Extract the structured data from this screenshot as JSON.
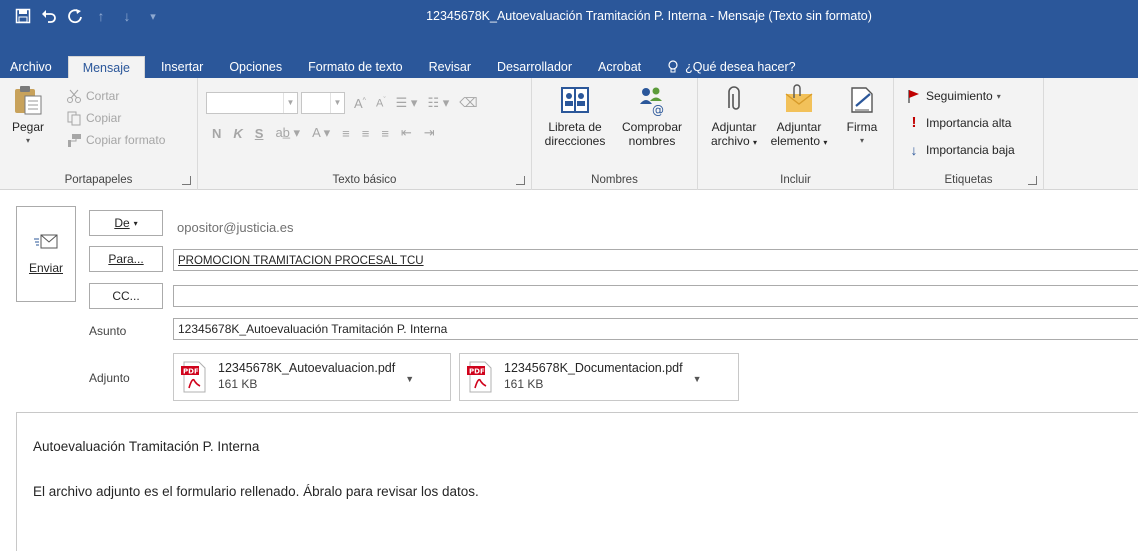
{
  "window": {
    "title": "12345678K_Autoevaluación Tramitación P. Interna  -  Mensaje (Texto sin formato)"
  },
  "quick_access": [
    {
      "name": "save-icon",
      "glyph": "🖫"
    },
    {
      "name": "undo-icon",
      "glyph": "↶"
    },
    {
      "name": "redo-icon",
      "glyph": "↻"
    },
    {
      "name": "up-arrow-icon",
      "glyph": "↑"
    },
    {
      "name": "down-arrow-icon",
      "glyph": "↓"
    },
    {
      "name": "customize-qat-icon",
      "glyph": "₹"
    }
  ],
  "tabs": [
    {
      "label": "Archivo"
    },
    {
      "label": "Mensaje",
      "active": true
    },
    {
      "label": "Insertar"
    },
    {
      "label": "Opciones"
    },
    {
      "label": "Formato de texto"
    },
    {
      "label": "Revisar"
    },
    {
      "label": "Desarrollador"
    },
    {
      "label": "Acrobat"
    }
  ],
  "tell_me": "¿Qué desea hacer?",
  "ribbon": {
    "clipboard": {
      "label": "Portapapeles",
      "paste": "Pegar",
      "cut": "Cortar",
      "copy": "Copiar",
      "format_painter": "Copiar formato"
    },
    "basic_text": {
      "label": "Texto básico",
      "bold": "N",
      "italic": "K",
      "underline": "S"
    },
    "names": {
      "label": "Nombres",
      "address_book_1": "Libreta de",
      "address_book_2": "direcciones",
      "check_names_1": "Comprobar",
      "check_names_2": "nombres"
    },
    "include": {
      "label": "Incluir",
      "attach_file_1": "Adjuntar",
      "attach_file_2": "archivo",
      "attach_item_1": "Adjuntar",
      "attach_item_2": "elemento",
      "signature": "Firma"
    },
    "tags": {
      "label": "Etiquetas",
      "follow_up": "Seguimiento",
      "high_importance": "Importancia alta",
      "low_importance": "Importancia baja"
    }
  },
  "compose": {
    "send": "Enviar",
    "from_button": "De",
    "from_value": "opositor@justicia.es",
    "to_button": "Para...",
    "to_value": "PROMOCION TRAMITACION PROCESAL TCU",
    "cc_button": "CC...",
    "cc_value": "",
    "subject_label": "Asunto",
    "subject_value": "12345678K_Autoevaluación Tramitación P. Interna",
    "attachment_label": "Adjunto",
    "attachments": [
      {
        "name": "12345678K_Autoevaluacion.pdf",
        "size": "161 KB"
      },
      {
        "name": "12345678K_Documentacion.pdf",
        "size": "161 KB"
      }
    ],
    "body_line_1": "Autoevaluación Tramitación P. Interna",
    "body_line_2": "El archivo adjunto es el formulario rellenado. Ábralo para revisar los datos."
  },
  "colors": {
    "accent": "#2b579a",
    "ribbon_bg": "#f3f3f3",
    "high_importance": "#c00000",
    "low_importance": "#2b579a"
  }
}
